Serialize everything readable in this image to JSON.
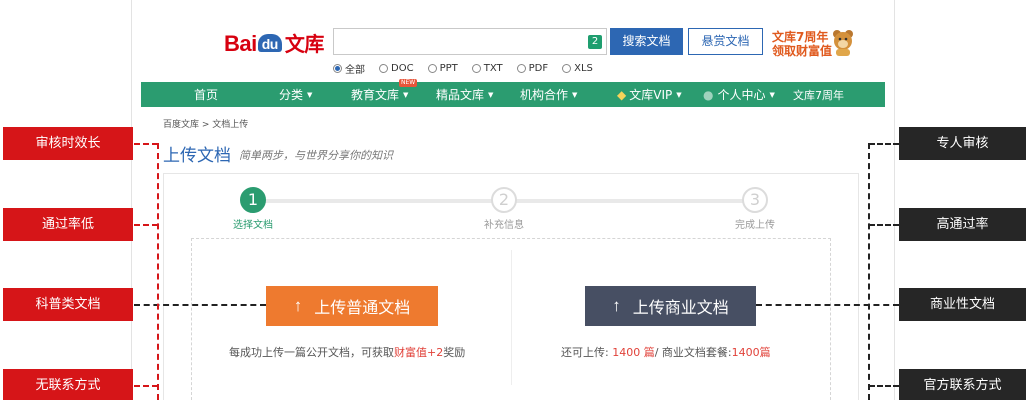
{
  "header": {
    "logo_bai": "Bai",
    "logo_du": "du",
    "logo_wenku": "文库",
    "search_badge": "2",
    "search_button": "搜索文档",
    "reward_button": "悬赏文档",
    "promo_line1": "文库7周年",
    "promo_line2": "领取财富值",
    "filters": [
      {
        "label": "全部",
        "selected": true
      },
      {
        "label": "DOC",
        "selected": false
      },
      {
        "label": "PPT",
        "selected": false
      },
      {
        "label": "TXT",
        "selected": false
      },
      {
        "label": "PDF",
        "selected": false
      },
      {
        "label": "XLS",
        "selected": false
      }
    ]
  },
  "nav": {
    "home": "首页",
    "category": "分类",
    "education": "教育文库",
    "education_badge": "NEW",
    "premium": "精品文库",
    "institution": "机构合作",
    "vip": "文库VIP",
    "user": "个人中心",
    "anniversary": "文库7周年"
  },
  "breadcrumb": "百度文库 > 文档上传",
  "upload": {
    "title": "上传文档",
    "slogan": "简单两步，与世界分享你的知识"
  },
  "steps": [
    {
      "number": "1",
      "label": "选择文档",
      "active": true
    },
    {
      "number": "2",
      "label": "补充信息",
      "active": false
    },
    {
      "number": "3",
      "label": "完成上传",
      "active": false
    }
  ],
  "normal_upload": {
    "arrow": "↑",
    "label": "上传普通文档",
    "desc_prefix": "每成功上传一篇公开文档，可获取",
    "desc_highlight": "财富值+2",
    "desc_suffix": "奖励"
  },
  "commercial_upload": {
    "arrow": "↑",
    "label": "上传商业文档",
    "desc_prefix": "还可上传: ",
    "desc_count": "1400 篇",
    "desc_middle": "/ 商业文档套餐:",
    "desc_package": "1400篇"
  },
  "annotations": {
    "left": [
      "审核时效长",
      "通过率低",
      "科普类文档",
      "无联系方式"
    ],
    "right": [
      "专人审核",
      "高通过率",
      "商业性文档",
      "官方联系方式"
    ]
  },
  "colors": {
    "brand_blue": "#2d67b3",
    "nav_green": "#2b9c70",
    "orange": "#ee7a2f",
    "slate": "#474f63",
    "annotation_red": "#d61518",
    "annotation_dark": "#262626"
  }
}
